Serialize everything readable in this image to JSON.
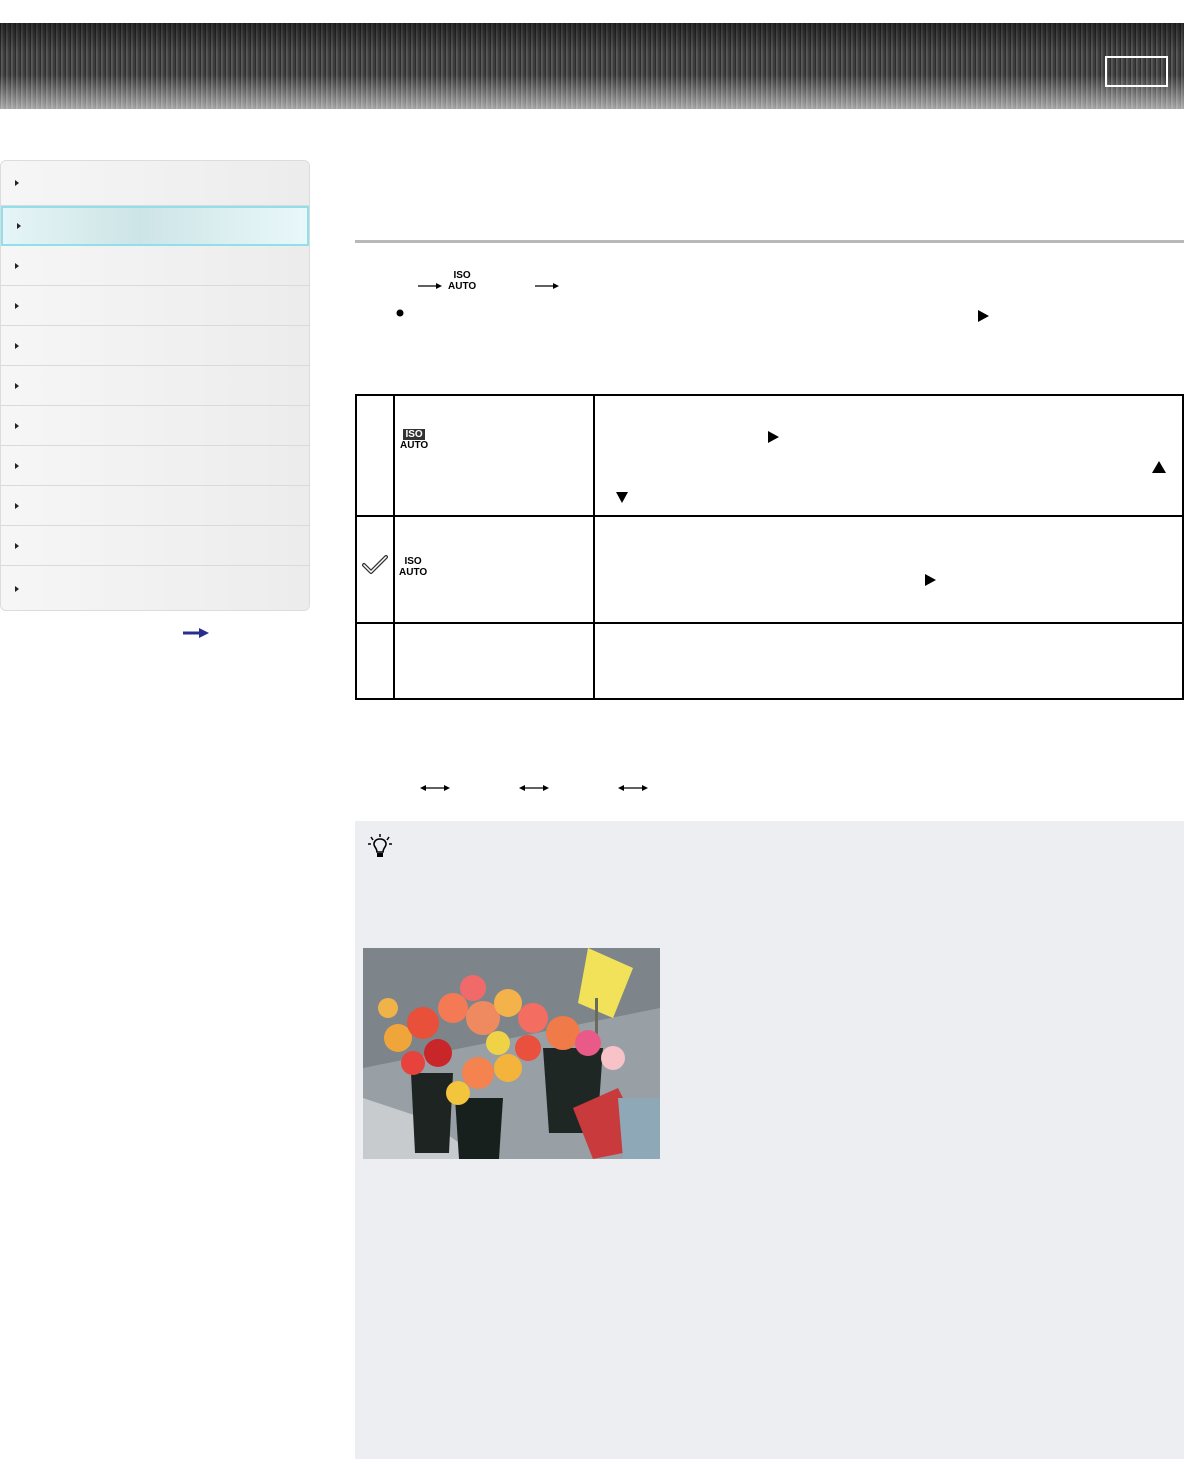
{
  "header": {
    "box_label": ""
  },
  "sidebar": {
    "items": [
      {
        "label": "",
        "active": false
      },
      {
        "label": "",
        "active": true
      },
      {
        "label": "",
        "active": false
      },
      {
        "label": "",
        "active": false
      },
      {
        "label": "",
        "active": false
      },
      {
        "label": "",
        "active": false
      },
      {
        "label": "",
        "active": false
      },
      {
        "label": "",
        "active": false
      },
      {
        "label": "",
        "active": false
      },
      {
        "label": "",
        "active": false
      },
      {
        "label": "",
        "active": false
      }
    ],
    "more_icon": "right-arrow-icon"
  },
  "main": {
    "steps": {
      "iso_top": "ISO",
      "iso_bottom": "AUTO"
    },
    "table": {
      "rows": [
        {
          "icon_top": "ISO",
          "icon_bottom": "AUTO",
          "checked": false
        },
        {
          "icon_top": "ISO",
          "icon_bottom": "AUTO",
          "checked": true
        },
        {
          "icon_top": "",
          "icon_bottom": "",
          "checked": false
        }
      ]
    },
    "tip": {
      "icon": "lightbulb-icon"
    }
  },
  "colors": {
    "sidebar_active_border": "#8fe0ea",
    "tip_background": "#eceef2",
    "rule": "#b8b8b8",
    "more_arrow": "#2b2f8c"
  }
}
